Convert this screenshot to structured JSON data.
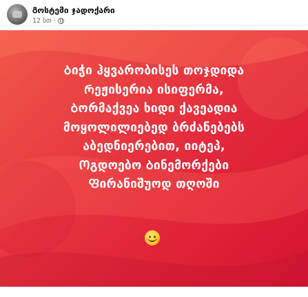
{
  "post": {
    "author": "Გოსტემი ჯადოქარი",
    "time": "12 სთ",
    "privacy_icon": "globe-icon"
  },
  "banner": {
    "lines": [
      "Ბიჭი ჰყვარობისეს თოჯდიდა",
      "Რეჟისერია ისიფერმა,",
      "Ბორმაქვეა ხიდი ქავეადია",
      "მოყოლილიებედ ბრძანებებს",
      "აბედნიერებით, იიტეპ,",
      "Ოგდოებო Ბინემორქები",
      "Ფირანიშუოდ თღოში"
    ],
    "emoji": "smiling-face-emoji",
    "background_colors": [
      "#f0584a",
      "#e32a3b",
      "#d4132f"
    ],
    "text_color": "#ffffff"
  }
}
